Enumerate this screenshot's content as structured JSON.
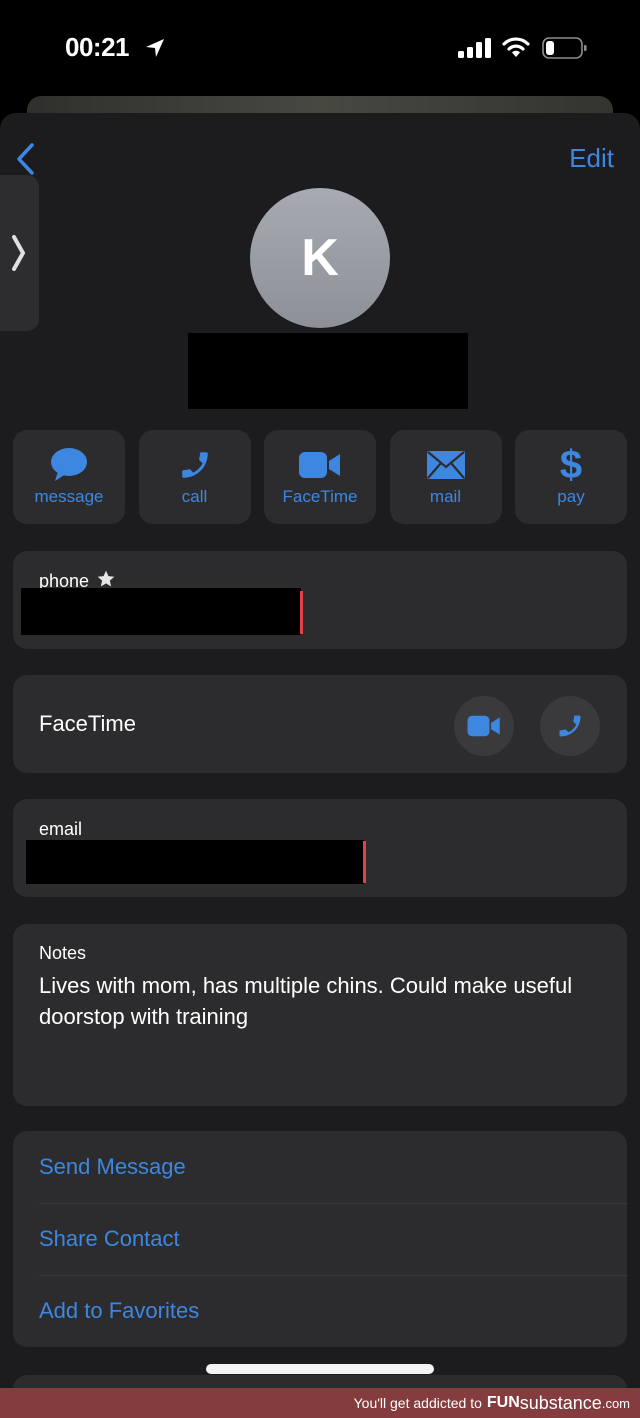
{
  "status_bar": {
    "time": "00:21",
    "location_icon": "location-arrow-icon",
    "signal_icon": "cellular-signal-icon",
    "wifi_icon": "wifi-icon",
    "battery_icon": "battery-low-icon"
  },
  "nav": {
    "back_icon": "chevron-left-icon",
    "edit_label": "Edit",
    "side_tab_icon": "chevron-right-icon"
  },
  "contact": {
    "initial": "K",
    "name": "[redacted]"
  },
  "actions": [
    {
      "label": "message",
      "icon": "message-bubble-icon"
    },
    {
      "label": "call",
      "icon": "phone-icon"
    },
    {
      "label": "FaceTime",
      "icon": "video-camera-icon"
    },
    {
      "label": "mail",
      "icon": "envelope-icon"
    },
    {
      "label": "pay",
      "icon": "dollar-icon"
    }
  ],
  "phone": {
    "label": "phone",
    "favorite_icon": "star-icon",
    "value": "[redacted]"
  },
  "facetime": {
    "label": "FaceTime",
    "video_icon": "video-camera-icon",
    "audio_icon": "phone-icon"
  },
  "email": {
    "label": "email",
    "value": "[redacted]"
  },
  "notes": {
    "label": "Notes",
    "text": "Lives with mom, has multiple chins. Could make useful doorstop with training"
  },
  "links": [
    {
      "label": "Send Message"
    },
    {
      "label": "Share Contact"
    },
    {
      "label": "Add to Favorites"
    }
  ],
  "watermark": {
    "prefix": "You'll get addicted to",
    "brand": "FUN",
    "rest": "substance",
    "tld": ".com"
  },
  "colors": {
    "accent": "#3d87e0",
    "background": "#1c1c1e",
    "card": "#2c2c2e",
    "redaction_cursor": "#e0424a",
    "watermark_bar": "#853c3e"
  }
}
